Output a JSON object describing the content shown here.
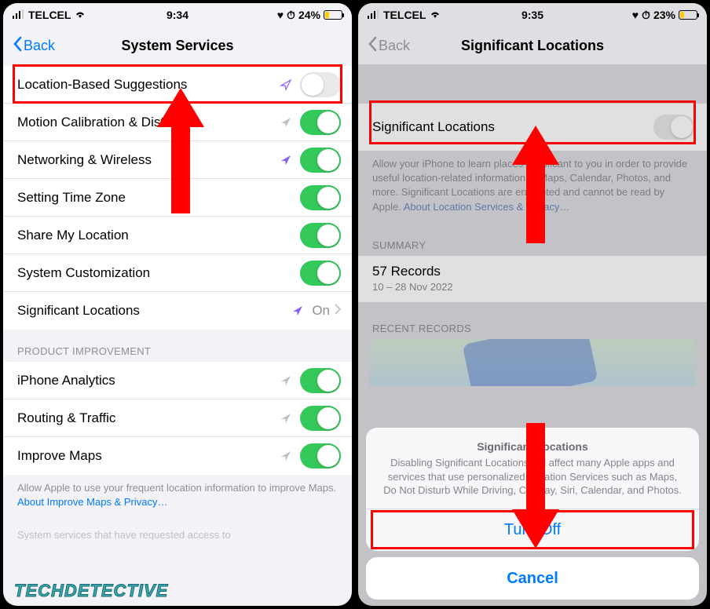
{
  "left": {
    "status": {
      "carrier": "TELCEL",
      "time": "9:34",
      "battery_text": "24%"
    },
    "nav": {
      "back": "Back",
      "title": "System Services"
    },
    "rows": [
      {
        "label": "Location-Based Suggestions",
        "icon": "purple-outline",
        "toggle": false
      },
      {
        "label": "Motion Calibration & Distance",
        "icon": "gray",
        "toggle": true
      },
      {
        "label": "Networking & Wireless",
        "icon": "purple",
        "toggle": true
      },
      {
        "label": "Setting Time Zone",
        "icon": "none",
        "toggle": true
      },
      {
        "label": "Share My Location",
        "icon": "none",
        "toggle": true
      },
      {
        "label": "System Customization",
        "icon": "none",
        "toggle": true
      },
      {
        "label": "Significant Locations",
        "icon": "purple",
        "value": "On"
      }
    ],
    "group2_header": "PRODUCT IMPROVEMENT",
    "rows2": [
      {
        "label": "iPhone Analytics",
        "icon": "gray",
        "toggle": true
      },
      {
        "label": "Routing & Traffic",
        "icon": "gray",
        "toggle": true
      },
      {
        "label": "Improve Maps",
        "icon": "gray",
        "toggle": true
      }
    ],
    "footer": "Allow Apple to use your frequent location information to improve Maps. ",
    "footer_link": "About Improve Maps & Privacy…",
    "footer2": "System services that have requested access to",
    "watermark": "TECHDETECTIVE"
  },
  "right": {
    "status": {
      "carrier": "TELCEL",
      "time": "9:35",
      "battery_text": "23%"
    },
    "nav": {
      "back": "Back",
      "title": "Significant Locations"
    },
    "row_label": "Significant Locations",
    "desc": "Allow your iPhone to learn places significant to you in order to provide useful location-related information in Maps, Calendar, Photos, and more. Significant Locations are encrypted and cannot be read by Apple. ",
    "desc_link": "About Location Services & Privacy…",
    "summary_header": "SUMMARY",
    "summary_title": "57 Records",
    "summary_sub": "10 – 28 Nov 2022",
    "recent_header": "RECENT RECORDS",
    "sheet": {
      "title": "Significant Locations",
      "desc": "Disabling Significant Locations will affect many Apple apps and services that use personalized Location Services such as Maps, Do Not Disturb While Driving, CarPlay, Siri, Calendar, and Photos.",
      "turn_off": "Turn Off",
      "cancel": "Cancel"
    }
  }
}
